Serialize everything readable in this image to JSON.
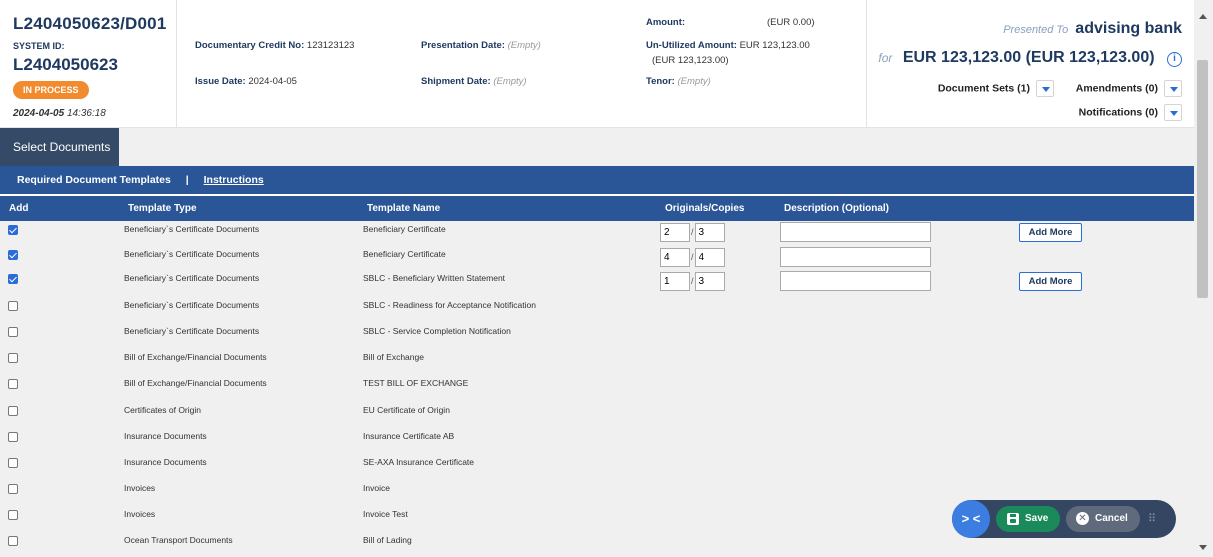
{
  "header": {
    "reference": "L2404050623/D001",
    "system_id_label": "SYSTEM ID:",
    "system_id": "L2404050623",
    "status": "IN PROCESS",
    "timestamp_date": "2024-04-05",
    "timestamp_time": "14:36:18",
    "dc_no_label": "Documentary Credit No:",
    "dc_no": "123123123",
    "issue_date_label": "Issue Date:",
    "issue_date": "2024-04-05",
    "presentation_date_label": "Presentation Date:",
    "presentation_date": "(Empty)",
    "shipment_date_label": "Shipment Date:",
    "shipment_date": "(Empty)",
    "amount_label": "Amount:",
    "amount": "(EUR 0.00)",
    "unutilized_label": "Un-Utilized Amount:",
    "unutilized": "EUR 123,123.00",
    "unutilized_sub": "(EUR 123,123.00)",
    "tenor_label": "Tenor:",
    "tenor": "(Empty)",
    "presented_to_label": "Presented To",
    "presented_to": "advising bank",
    "for_label": "for",
    "for_amount": "EUR 123,123.00 (EUR 123,123.00)",
    "document_sets": "Document Sets (1)",
    "amendments": "Amendments (0)",
    "notifications": "Notifications (0)"
  },
  "tabs": {
    "select_documents": "Select Documents"
  },
  "subbar": {
    "required_templates": "Required Document Templates",
    "separator": "|",
    "instructions": "Instructions"
  },
  "table": {
    "columns": {
      "add": "Add",
      "template_type": "Template Type",
      "template_name": "Template Name",
      "originals_copies": "Originals/Copies",
      "description": "Description (Optional)"
    },
    "slash": "/",
    "add_more_label": "Add More",
    "rows": [
      {
        "checked": true,
        "type": "Beneficiary`s Certificate Documents",
        "name": "Beneficiary Certificate",
        "originals": "2",
        "copies": "3",
        "add_more": true
      },
      {
        "checked": true,
        "type": "Beneficiary`s Certificate Documents",
        "name": "Beneficiary Certificate",
        "originals": "4",
        "copies": "4",
        "add_more": false
      },
      {
        "checked": true,
        "type": "Beneficiary`s Certificate Documents",
        "name": "SBLC - Beneficiary Written Statement",
        "originals": "1",
        "copies": "3",
        "add_more": true
      },
      {
        "checked": false,
        "type": "Beneficiary`s Certificate Documents",
        "name": "SBLC - Readiness for Acceptance Notification"
      },
      {
        "checked": false,
        "type": "Beneficiary`s Certificate Documents",
        "name": "SBLC - Service Completion Notification"
      },
      {
        "checked": false,
        "type": "Bill of Exchange/Financial Documents",
        "name": "Bill of Exchange"
      },
      {
        "checked": false,
        "type": "Bill of Exchange/Financial Documents",
        "name": "TEST BILL OF EXCHANGE"
      },
      {
        "checked": false,
        "type": "Certificates of Origin",
        "name": "EU Certificate of Origin"
      },
      {
        "checked": false,
        "type": "Insurance Documents",
        "name": "Insurance Certificate AB"
      },
      {
        "checked": false,
        "type": "Insurance Documents",
        "name": "SE-AXA Insurance Certificate"
      },
      {
        "checked": false,
        "type": "Invoices",
        "name": "Invoice"
      },
      {
        "checked": false,
        "type": "Invoices",
        "name": "Invoice Test"
      },
      {
        "checked": false,
        "type": "Ocean Transport Documents",
        "name": "Bill of Lading"
      }
    ]
  },
  "actions": {
    "toggle": "> <",
    "save": "Save",
    "cancel": "Cancel",
    "grip": "⠿"
  },
  "icons": {
    "info": "info-circle-icon",
    "caret": "caret-down-icon",
    "save": "floppy-disk-icon",
    "cancel": "close-circle-icon"
  },
  "colors": {
    "status": "#f28a2e",
    "header_bar": "#2a5597",
    "tab": "#354a66",
    "save": "#1a8a5a",
    "accent": "#2b6cd6"
  }
}
